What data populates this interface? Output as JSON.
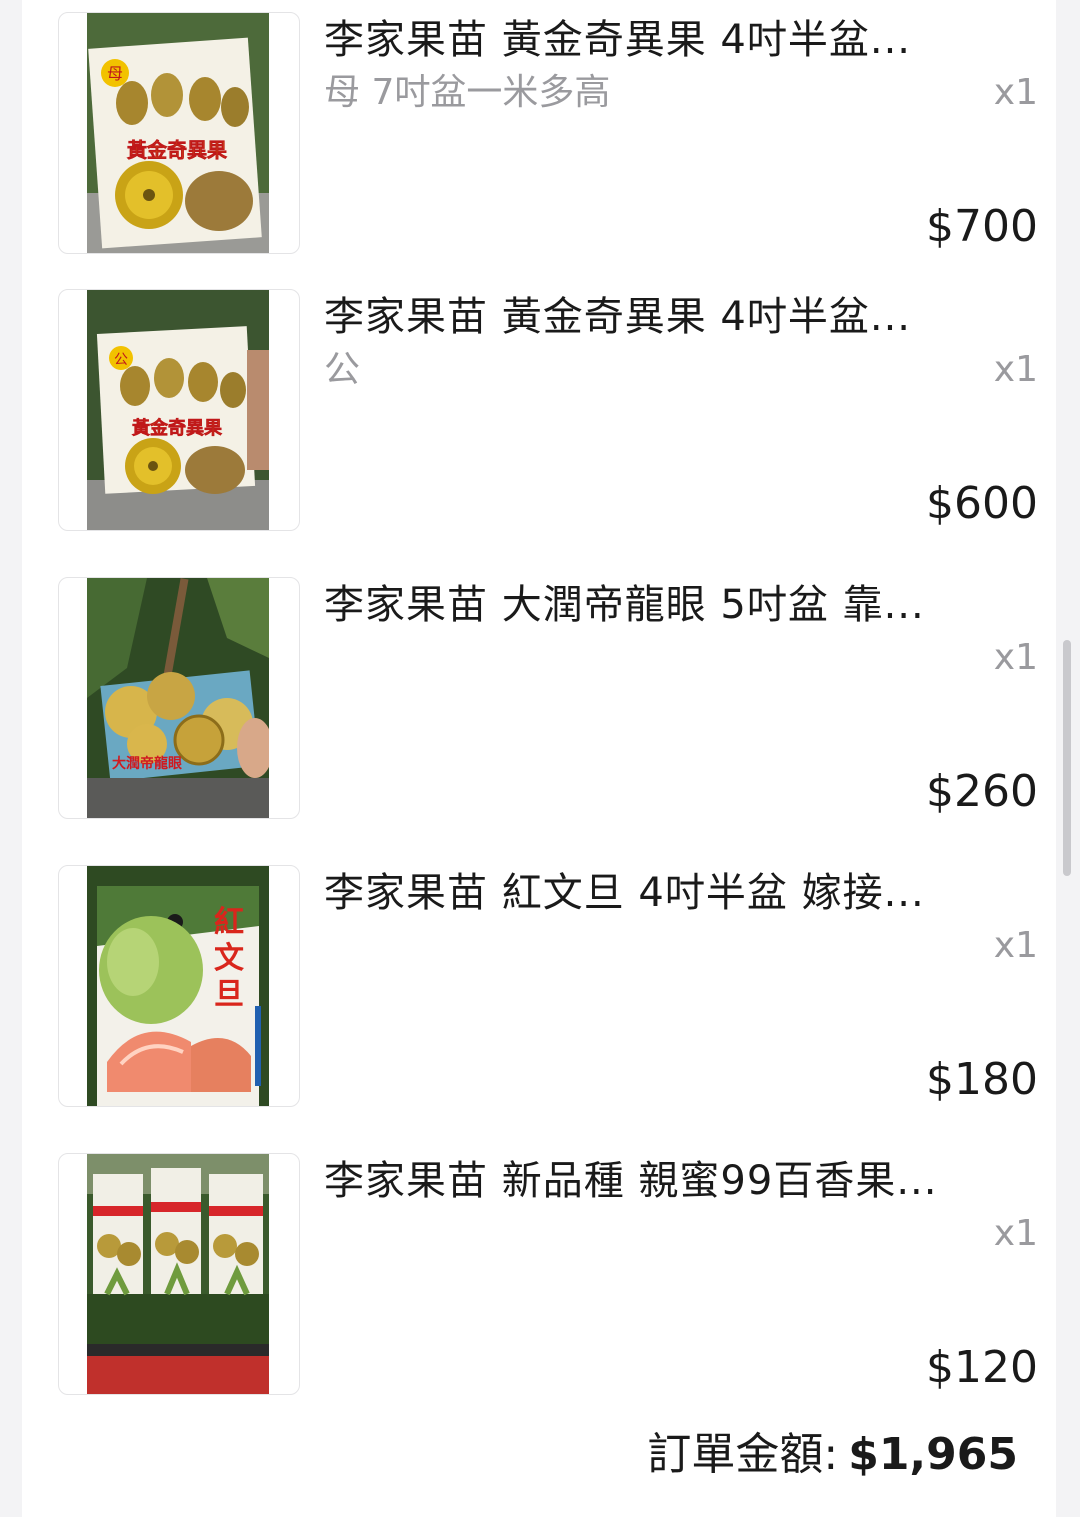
{
  "order": {
    "items": [
      {
        "title": "李家果苗 黃金奇異果 4吋半盆...",
        "variant": "母 7吋盆一米多高",
        "qty": "x1",
        "price": "$700",
        "image": {
          "label": "黃金奇異果",
          "badge": "母"
        }
      },
      {
        "title": "李家果苗 黃金奇異果 4吋半盆...",
        "variant": "公",
        "qty": "x1",
        "price": "$600",
        "image": {
          "label": "黃金奇異果",
          "badge": "公"
        }
      },
      {
        "title": "李家果苗 大潤帝龍眼 5吋盆 靠...",
        "variant": "",
        "qty": "x1",
        "price": "$260",
        "image": {
          "label": "大潤帝龍眼"
        }
      },
      {
        "title": "李家果苗 紅文旦 4吋半盆 嫁接...",
        "variant": "",
        "qty": "x1",
        "price": "$180",
        "image": {
          "label": "紅文旦"
        }
      },
      {
        "title": "李家果苗 新品種 親蜜99百香果...",
        "variant": "",
        "qty": "x1",
        "price": "$120",
        "image": {
          "label": ""
        }
      }
    ],
    "total_label": "訂單金額:",
    "total_value": "$1,965"
  },
  "colors": {
    "text": "#1a1a1a",
    "muted": "#9a9a9e",
    "background": "#f3f3f5",
    "card": "#ffffff"
  }
}
